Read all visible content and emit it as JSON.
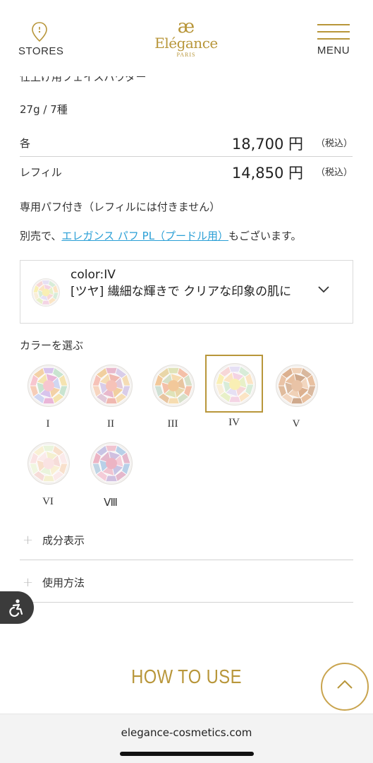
{
  "header": {
    "stores_label": "STORES",
    "logo_mark": "æ",
    "logo_word": "Elégance",
    "logo_sub": "PARIS",
    "menu_label": "MENU"
  },
  "product": {
    "cutoff_title": "仕上げ用フェイスパウダー",
    "size": "27g / 7種",
    "prices": [
      {
        "label": "各",
        "value": "18,700 円",
        "tax": "（税込）"
      },
      {
        "label": "レフィル",
        "value": "14,850 円",
        "tax": "（税込）"
      }
    ],
    "puff_note": "専用パフ付き（レフィルには付きません）",
    "puff_prefix": "別売で、",
    "puff_link": "エレガンス パフ PL（プードル用）",
    "puff_suffix": "もございます。"
  },
  "color_select": {
    "title": "color:IV",
    "description": "[ツヤ] 繊細な輝きで クリアな印象の肌に",
    "icon": "chevron-down-icon"
  },
  "colors": {
    "label": "カラーを選ぶ",
    "selected": "IV",
    "items": [
      {
        "id": "I",
        "palette": [
          "#f7c6cf",
          "#f3d1a6",
          "#d8c4ec",
          "#c9e4d0",
          "#f4e3b0",
          "#eab6d8",
          "#d0d6f2",
          "#f6cdb8"
        ]
      },
      {
        "id": "II",
        "palette": [
          "#f6c2b8",
          "#f1cf9f",
          "#e8b8cc",
          "#d9cde9",
          "#f5dcb4",
          "#f0b8b0",
          "#e2c9d9",
          "#f7d5c0"
        ]
      },
      {
        "id": "III",
        "palette": [
          "#f2c89a",
          "#e9d6a8",
          "#dfe3b8",
          "#f4c0a8",
          "#d6e0c8",
          "#f6dcb0",
          "#e8c5a0",
          "#cfe0d4"
        ]
      },
      {
        "id": "IV",
        "palette": [
          "#f9efb4",
          "#f7d7d7",
          "#e6e0f4",
          "#d8ecd8",
          "#fbe4c4",
          "#f4d4e4",
          "#e8f0c8",
          "#f9eed8"
        ]
      },
      {
        "id": "V",
        "palette": [
          "#e9c3a6",
          "#dcb08f",
          "#f0d1b7",
          "#d9b89e",
          "#e8c0a0",
          "#cfa98c",
          "#f2d6bf",
          "#e0bb9c"
        ]
      },
      {
        "id": "VI",
        "palette": [
          "#fae3e3",
          "#f9f0d4",
          "#eaf4dc",
          "#f8e0cc",
          "#fbeaea",
          "#f4f0d0",
          "#f6dcd8",
          "#f0f6e0"
        ]
      },
      {
        "id": "Ⅷ",
        "palette": [
          "#ecb4c4",
          "#c8c4e4",
          "#f0c4d0",
          "#b8d0e8",
          "#e4b8cc",
          "#d0c0e0",
          "#f4ccd8",
          "#c0d4e4"
        ]
      }
    ]
  },
  "accordions": [
    {
      "label": "成分表示",
      "icon": "plus-icon"
    },
    {
      "label": "使用方法",
      "icon": "plus-icon"
    }
  ],
  "accessibility_icon": "accessibility-icon",
  "howto_label": "HOW TO USE",
  "back_to_top_icon": "chevron-up-icon",
  "browser": {
    "url": "elegance-cosmetics.com"
  },
  "colors_theme": {
    "gold": "#b8963a",
    "link": "#2a9fd6",
    "divider": "#d2d2d2"
  }
}
